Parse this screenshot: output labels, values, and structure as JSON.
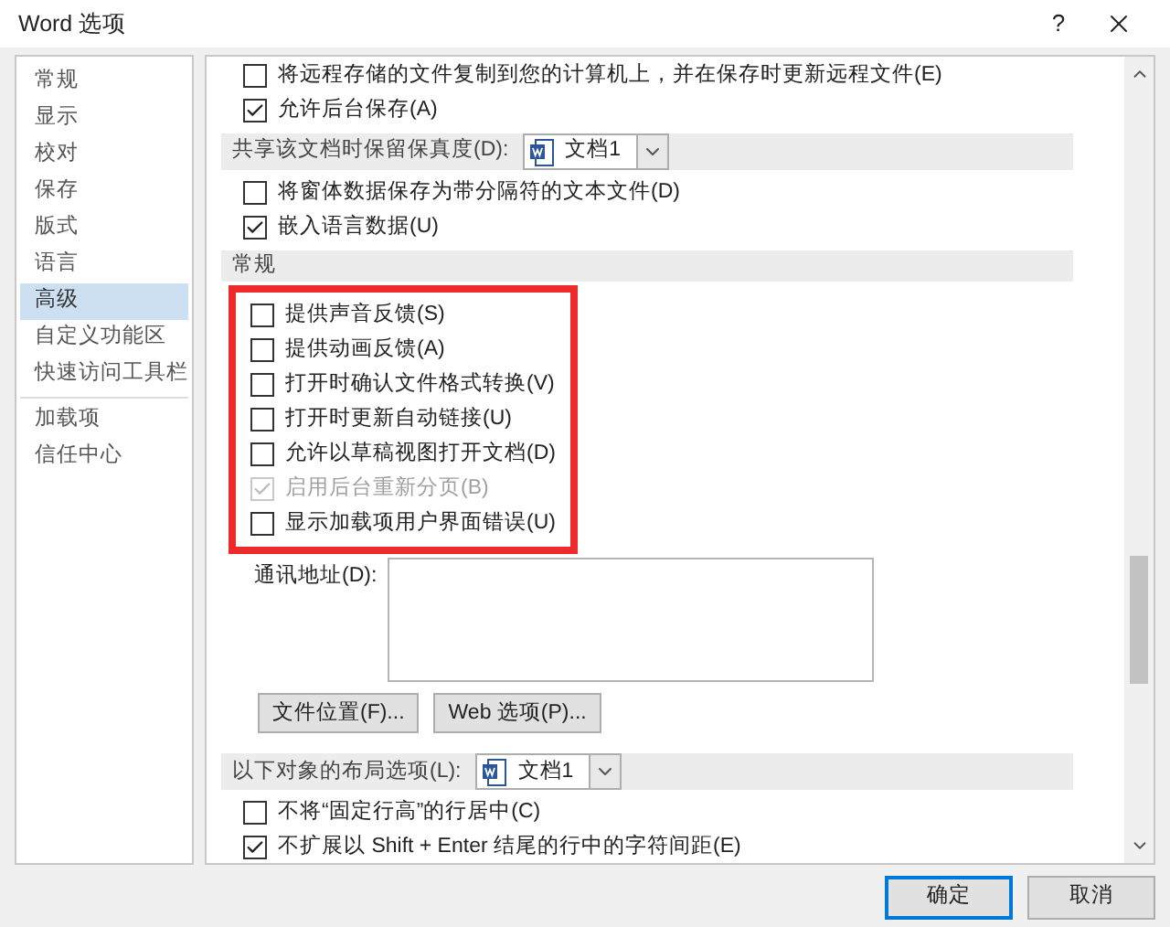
{
  "window": {
    "title": "Word 选项",
    "help": "?"
  },
  "sidebar": {
    "groups": [
      {
        "items": [
          {
            "label": "常规",
            "selected": false
          },
          {
            "label": "显示",
            "selected": false
          },
          {
            "label": "校对",
            "selected": false
          },
          {
            "label": "保存",
            "selected": false
          },
          {
            "label": "版式",
            "selected": false
          },
          {
            "label": "语言",
            "selected": false
          },
          {
            "label": "高级",
            "selected": true
          },
          {
            "label": "自定义功能区",
            "selected": false
          },
          {
            "label": "快速访问工具栏",
            "selected": false
          }
        ]
      },
      {
        "items": [
          {
            "label": "加载项",
            "selected": false
          },
          {
            "label": "信任中心",
            "selected": false
          }
        ]
      }
    ]
  },
  "content": [
    {
      "kind": "checkbox",
      "label": "将远程存储的文件复制到您的计算机上，并在保存时更新远程文件(E)",
      "checked": false,
      "disabled": false
    },
    {
      "kind": "checkbox",
      "label": "允许后台保存(A)",
      "checked": true,
      "disabled": false
    },
    {
      "kind": "select_header",
      "label": "共享该文档时保留保真度(D):",
      "value": "文档1"
    },
    {
      "kind": "checkbox",
      "label": "将窗体数据保存为带分隔符的文本文件(D)",
      "checked": false,
      "disabled": false
    },
    {
      "kind": "checkbox",
      "label": "嵌入语言数据(U)",
      "checked": true,
      "disabled": false
    },
    {
      "kind": "header",
      "label": "常规"
    },
    {
      "kind": "group",
      "outlined": true,
      "items": [
        {
          "label": "提供声音反馈(S)",
          "checked": false,
          "disabled": false
        },
        {
          "label": "提供动画反馈(A)",
          "checked": false,
          "disabled": false
        },
        {
          "label": "打开时确认文件格式转换(V)",
          "checked": false,
          "disabled": false
        },
        {
          "label": "打开时更新自动链接(U)",
          "checked": false,
          "disabled": false
        },
        {
          "label": "允许以草稿视图打开文档(D)",
          "checked": false,
          "disabled": false
        },
        {
          "label": "启用后台重新分页(B)",
          "checked": true,
          "disabled": true
        },
        {
          "label": "显示加载项用户界面错误(U)",
          "checked": false,
          "disabled": false
        }
      ]
    },
    {
      "kind": "textarea",
      "label": "通讯地址(D):"
    },
    {
      "kind": "buttons",
      "buttons": [
        "文件位置(F)...",
        "Web 选项(P)..."
      ]
    },
    {
      "kind": "select_header",
      "label": "以下对象的布局选项(L):",
      "value": "文档1"
    },
    {
      "kind": "checkbox",
      "label": "不将“固定行高”的行居中(C)",
      "checked": false,
      "disabled": false
    },
    {
      "kind": "checkbox",
      "label": "不扩展以 Shift + Enter 结尾的行中的字符间距(E)",
      "checked": true,
      "disabled": false
    }
  ],
  "footer": {
    "buttons": [
      {
        "label": "确定",
        "default": true
      },
      {
        "label": "取消",
        "default": false
      }
    ]
  }
}
